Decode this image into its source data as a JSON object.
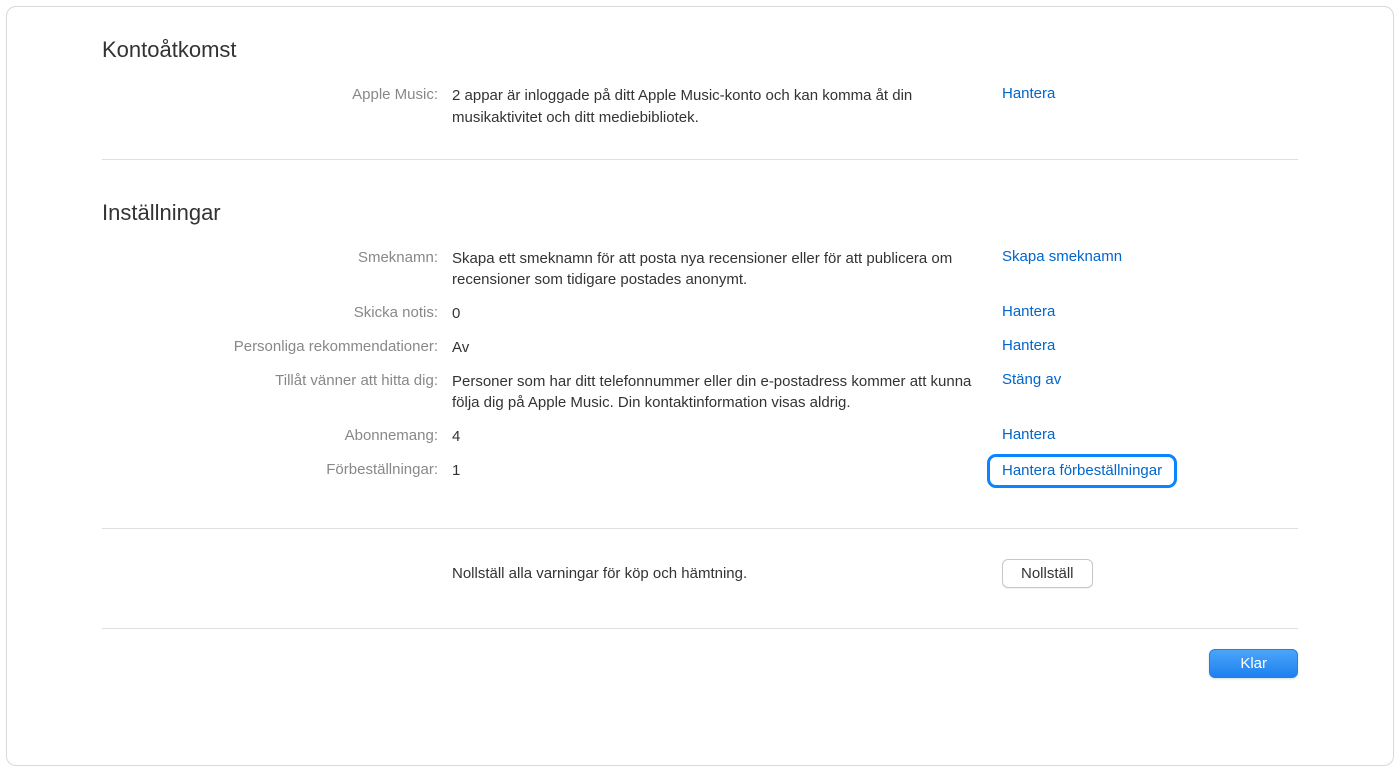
{
  "account_access": {
    "title": "Kontoåtkomst",
    "apple_music": {
      "label": "Apple Music:",
      "value": "2 appar är inloggade på ditt Apple Music-konto och kan komma åt din musikaktivitet och ditt mediebibliotek.",
      "action": "Hantera"
    }
  },
  "settings": {
    "title": "Inställningar",
    "nickname": {
      "label": "Smeknamn:",
      "value": "Skapa ett smeknamn för att posta nya recensioner eller för att publicera om recensioner som tidigare postades anonymt.",
      "action": "Skapa smeknamn"
    },
    "send_notice": {
      "label": "Skicka notis:",
      "value": "0",
      "action": "Hantera"
    },
    "personal_recs": {
      "label": "Personliga rekommendationer:",
      "value": "Av",
      "action": "Hantera"
    },
    "allow_friends": {
      "label": "Tillåt vänner att hitta dig:",
      "value": "Personer som har ditt telefonnummer eller din e-postadress kommer att kunna följa dig på Apple Music. Din kontaktinformation visas aldrig.",
      "action": "Stäng av"
    },
    "subscriptions": {
      "label": "Abonnemang:",
      "value": "4",
      "action": "Hantera"
    },
    "preorders": {
      "label": "Förbeställningar:",
      "value": "1",
      "action": "Hantera förbeställningar"
    }
  },
  "reset": {
    "description": "Nollställ alla varningar för köp och hämtning.",
    "button": "Nollställ"
  },
  "footer": {
    "done": "Klar"
  }
}
